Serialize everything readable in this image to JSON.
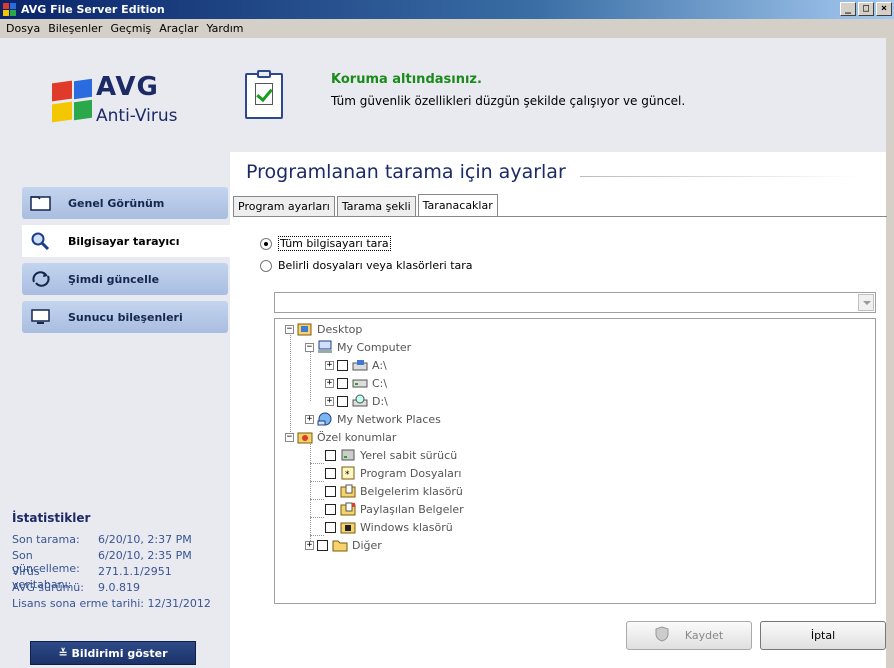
{
  "window": {
    "title": "AVG File Server Edition",
    "buttons": {
      "minimize": "_",
      "maximize": "□",
      "close": "×"
    }
  },
  "menu": [
    "Dosya",
    "Bileşenler",
    "Geçmiş",
    "Araçlar",
    "Yardım"
  ],
  "logo": {
    "brand": "AVG",
    "product": "Anti-Virus"
  },
  "status": {
    "title": "Koruma altındasınız.",
    "description": "Tüm güvenlik özellikleri düzgün şekilde çalışıyor ve güncel."
  },
  "nav": [
    {
      "label": "Genel Görünüm",
      "icon": "folder-icon",
      "active": false
    },
    {
      "label": "Bilgisayar tarayıcı",
      "icon": "magnifier-icon",
      "active": true
    },
    {
      "label": "Şimdi güncelle",
      "icon": "update-icon",
      "active": false
    },
    {
      "label": "Sunucu bileşenleri",
      "icon": "monitor-icon",
      "active": false
    }
  ],
  "stats": {
    "title": "İstatistikler",
    "rows": [
      {
        "key": "Son tarama:",
        "value": "6/20/10, 2:37 PM"
      },
      {
        "key": "Son güncelleme:",
        "value": "6/20/10, 2:35 PM"
      },
      {
        "key": "Virüs veritabanı:",
        "value": "271.1.1/2951"
      },
      {
        "key": "AVG sürümü:",
        "value": "9.0.819"
      }
    ],
    "license": "Lisans sona erme tarihi: 12/31/2012"
  },
  "notify_button": "≚ Bildirimi göster",
  "page": {
    "title": "Programlanan tarama için ayarlar",
    "tabs": [
      "Program ayarları",
      "Tarama şekli",
      "Taranacaklar"
    ],
    "active_tab": "Taranacaklar",
    "radios": [
      {
        "label": "Tüm bilgisayarı tara",
        "checked": true
      },
      {
        "label": "Belirli dosyaları veya klasörleri tara",
        "checked": false
      }
    ],
    "combo_value": ""
  },
  "tree": {
    "desktop": "Desktop",
    "my_computer": "My Computer",
    "drive_a": "A:\\",
    "drive_c": "C:\\",
    "drive_d": "D:\\",
    "network": "My Network Places",
    "special": "Özel konumlar",
    "special_items": [
      "Yerel sabit sürücü",
      "Program Dosyaları",
      "Belgelerim klasörü",
      "Paylaşılan Belgeler",
      "Windows klasörü",
      "Diğer"
    ]
  },
  "buttons": {
    "save": "Kaydet",
    "cancel": "İptal"
  },
  "colors": {
    "accent": "#1c2a66",
    "status_green": "#1a8a1a",
    "nav_blue": "#a9bde0"
  }
}
